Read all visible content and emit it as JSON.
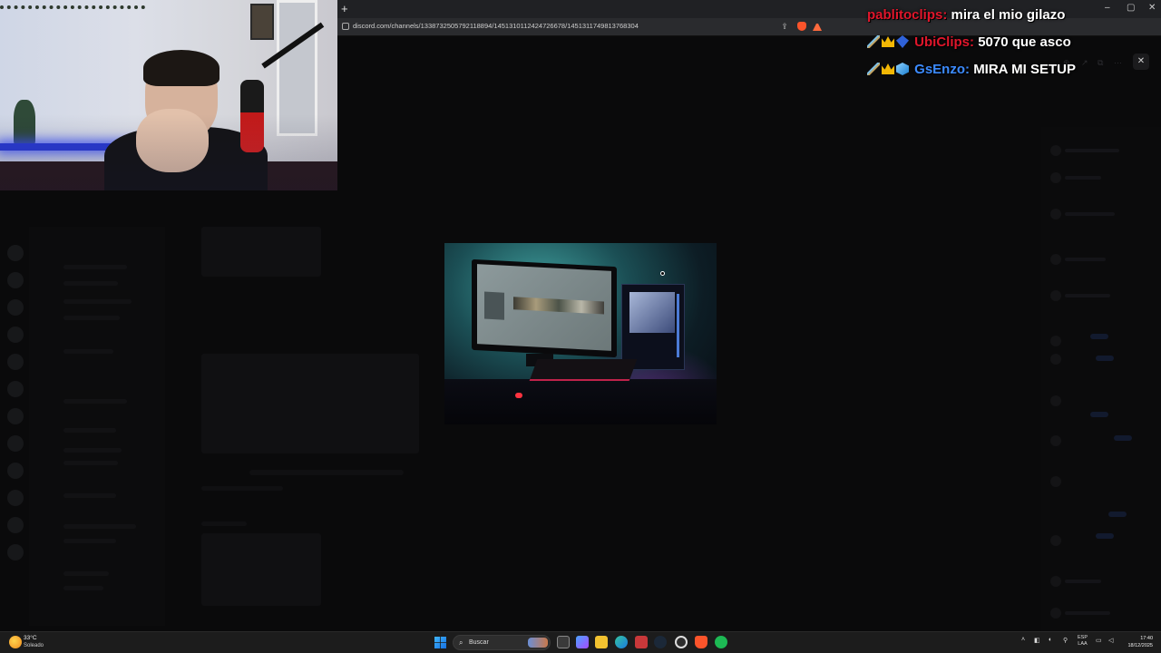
{
  "browser": {
    "new_tab_glyph": "+",
    "url": "discord.com/channels/1338732505792118894/1451310112424726678/1451311749813768304",
    "window_controls": [
      "–",
      "▢",
      "✕"
    ],
    "icons": [
      "share-icon",
      "brave-shield-icon",
      "brave-rewards-icon"
    ]
  },
  "image_modal": {
    "close_glyph": "✕",
    "tool_icons": [
      "zoom-icon",
      "share-icon",
      "open-external-icon",
      "more-icon"
    ]
  },
  "chat": [
    {
      "badges": [],
      "user": "pablitoclips:",
      "message": "mira el mio gilazo",
      "user_color": "#e0162b"
    },
    {
      "badges": [
        "sword-badge",
        "crown-badge",
        "gem-badge"
      ],
      "user": "UbiClips:",
      "message": "5070 que asco",
      "user_color": "#e0162b"
    },
    {
      "badges": [
        "sword-badge",
        "crown-badge",
        "cube-badge"
      ],
      "user": "GsEnzo:",
      "message": "MIRA MI SETUP",
      "user_color": "#3c8bff"
    }
  ],
  "taskbar": {
    "weather_temp": "33°C",
    "weather_desc": "Soleado",
    "search_placeholder": "Buscar",
    "lang_line1": "ESP",
    "lang_line2": "LAA",
    "time": "17:40",
    "date": "18/12/2025",
    "apps": [
      "start-icon",
      "task-view-icon",
      "widgets-icon",
      "file-explorer-icon",
      "edge-icon",
      "calendar-app-icon",
      "steam-icon",
      "obs-icon",
      "brave-icon",
      "spotify-icon"
    ]
  },
  "colors": {
    "accent_red": "#e0162b",
    "accent_blue": "#3c8bff",
    "taskbar_bg": "#1c1c1c"
  }
}
